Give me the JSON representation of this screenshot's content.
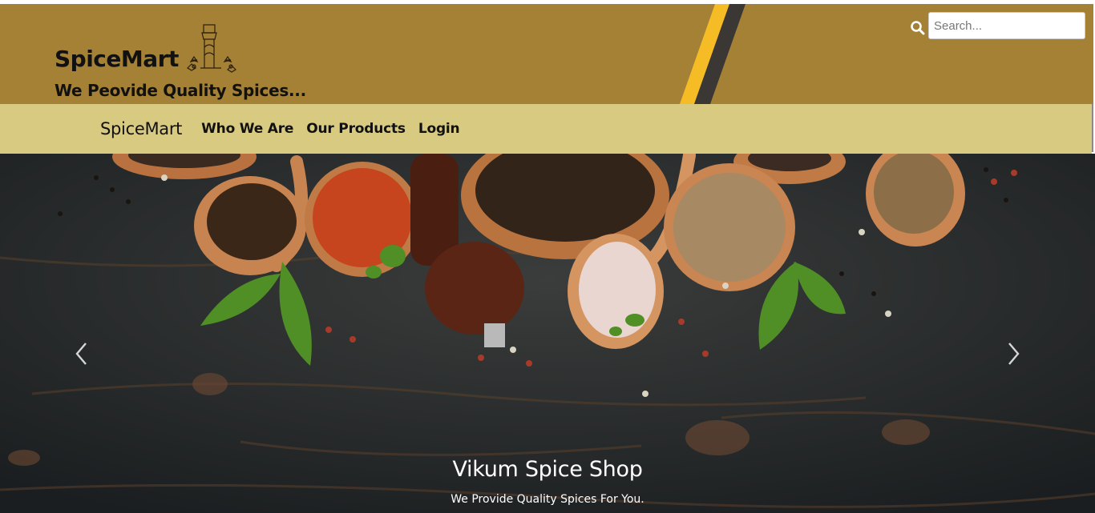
{
  "header": {
    "brand": "SpiceMart",
    "tagline": "We Peovide Quality Spices...",
    "logo_icon": "spice-bottle-icon",
    "search": {
      "placeholder": "Search...",
      "value": "",
      "icon": "search-icon"
    }
  },
  "nav": {
    "brand": "SpiceMart",
    "links": [
      "Who We Are",
      "Our Products",
      "Login"
    ]
  },
  "carousel": {
    "title": "Vikum Spice Shop",
    "subtitle": "We Provide Quality Spices For You.",
    "prev_icon": "chevron-left-icon",
    "next_icon": "chevron-right-icon"
  },
  "colors": {
    "header_bg": "#a48135",
    "nav_bg": "#d9ca82",
    "stripe_yellow": "#f6bc26",
    "stripe_dark": "#3a3734",
    "carousel_bg": "#262a2c"
  }
}
